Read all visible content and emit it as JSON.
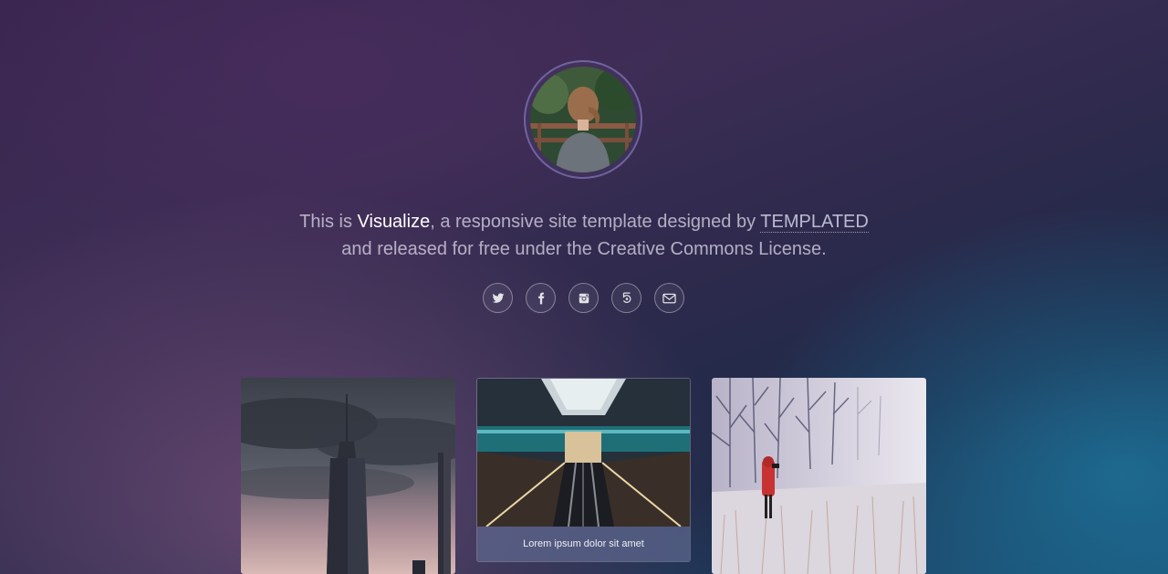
{
  "intro": {
    "prefix": "This is ",
    "site_name": "Visualize",
    "middle": ", a responsive site template designed by ",
    "author": "TEMPLATED",
    "line2": "and released for free under the Creative Commons License."
  },
  "social": [
    {
      "icon": "twitter-icon"
    },
    {
      "icon": "facebook-icon"
    },
    {
      "icon": "instagram-icon"
    },
    {
      "icon": "fivehundredpx-icon"
    },
    {
      "icon": "email-icon"
    }
  ],
  "gallery": {
    "items": [
      {
        "subject": "city skyscraper at dusk"
      },
      {
        "subject": "escalators in station",
        "caption": "Lorem ipsum dolor sit amet"
      },
      {
        "subject": "person in red coat in snowy field"
      }
    ]
  },
  "colors": {
    "background_top_left": "#3a2550",
    "background_bottom_right": "#1b4c70",
    "text": "#e6e1f0",
    "accent_pink": "#965f8c"
  }
}
